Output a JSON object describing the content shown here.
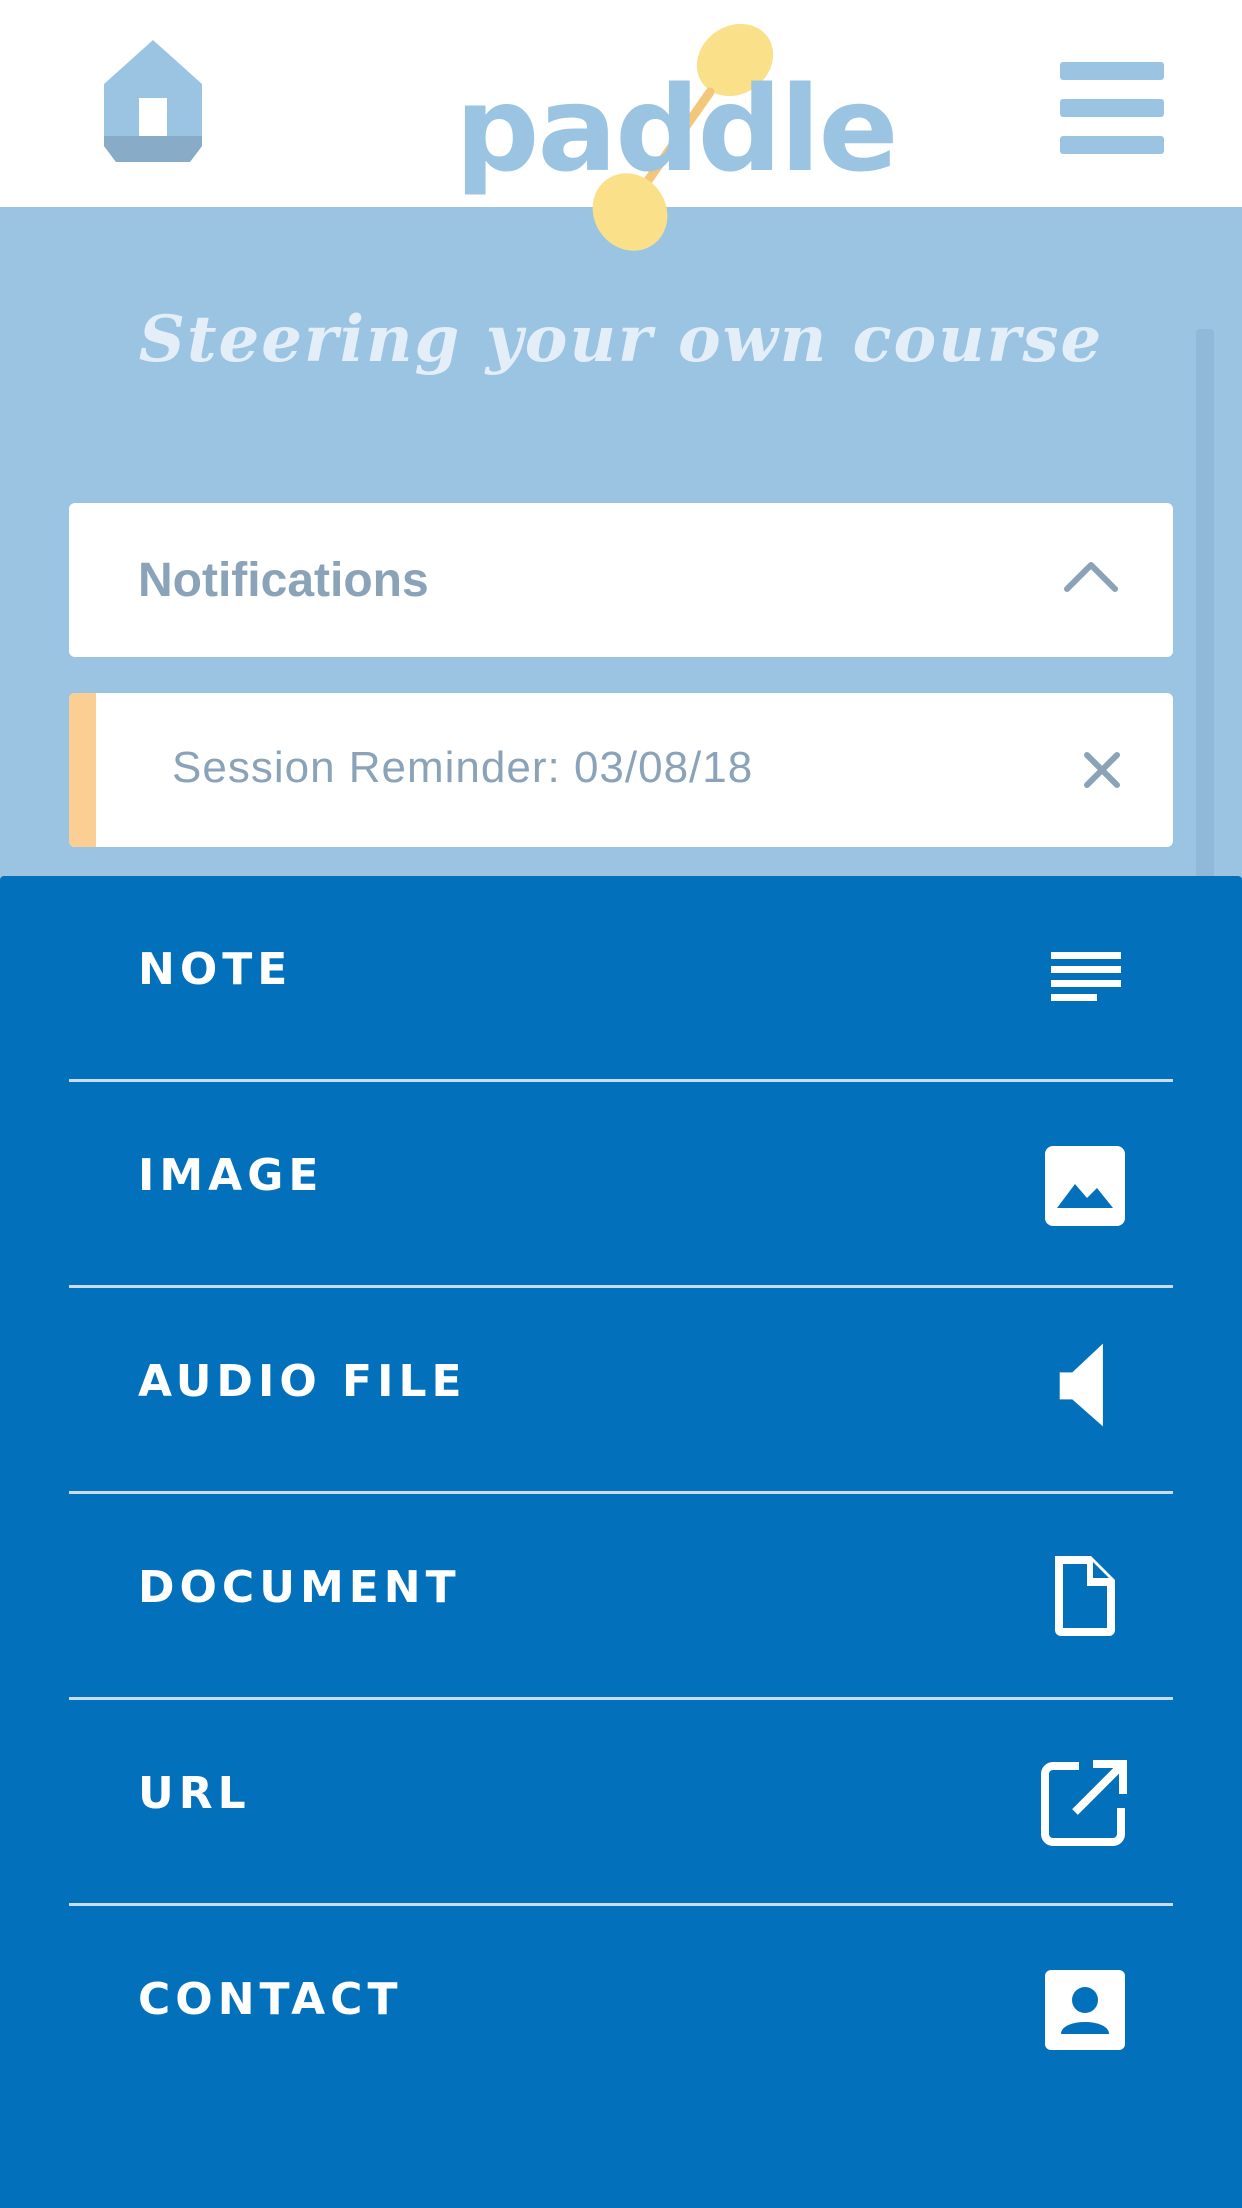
{
  "header": {
    "logo_text": "paddle",
    "home_icon": "home-icon",
    "menu_icon": "hamburger-menu-icon"
  },
  "hero": {
    "tagline": "Steering your own course"
  },
  "notifications": {
    "title": "Notifications",
    "toggle_icon": "chevron-up-icon",
    "items": [
      {
        "text": "Session Reminder: 03/08/18",
        "accent_color": "#fbcf93",
        "dismiss_icon": "close-icon"
      }
    ]
  },
  "add_menu": {
    "items": [
      {
        "label": "NOTE",
        "icon": "note-lines-icon"
      },
      {
        "label": "IMAGE",
        "icon": "image-icon"
      },
      {
        "label": "AUDIO FILE",
        "icon": "speaker-icon"
      },
      {
        "label": "DOCUMENT",
        "icon": "document-icon"
      },
      {
        "label": "URL",
        "icon": "external-link-icon"
      },
      {
        "label": "CONTACT",
        "icon": "contact-card-icon"
      }
    ]
  },
  "colors": {
    "brand_blue": "#0370bb",
    "light_blue": "#9bc4e3",
    "logo_yellow": "#fbe08a",
    "accent_orange": "#fbcf93"
  }
}
